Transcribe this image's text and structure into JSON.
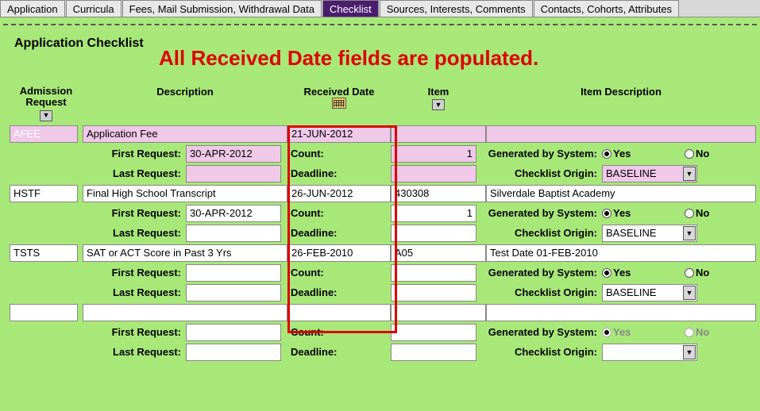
{
  "tabs": [
    "Application",
    "Curricula",
    "Fees, Mail Submission, Withdrawal Data",
    "Checklist",
    "Sources, Interests, Comments",
    "Contacts, Cohorts, Attributes"
  ],
  "active_tab_index": 3,
  "title": "Application Checklist",
  "annotation": "All Received Date fields are populated.",
  "columns": {
    "admission_request": "Admission\nRequest",
    "description": "Description",
    "received_date": "Received Date",
    "item": "Item",
    "item_description": "Item Description"
  },
  "labels": {
    "first_request": "First Request:",
    "last_request": "Last Request:",
    "count": "Count:",
    "deadline": "Deadline:",
    "generated_by_system": "Generated by System:",
    "checklist_origin": "Checklist Origin:",
    "yes": "Yes",
    "no": "No"
  },
  "rows": [
    {
      "code": "AFEE",
      "desc": "Application Fee",
      "received": "21-JUN-2012",
      "item": "",
      "item_desc": "",
      "first_request": "30-APR-2012",
      "last_request": "",
      "count": "1",
      "deadline": "",
      "gen_yes": true,
      "gen_disabled": false,
      "origin": "BASELINE",
      "highlight": true
    },
    {
      "code": "HSTF",
      "desc": "Final High School Transcript",
      "received": "26-JUN-2012",
      "item": "430308",
      "item_desc": "Silverdale Baptist Academy",
      "first_request": "30-APR-2012",
      "last_request": "",
      "count": "1",
      "deadline": "",
      "gen_yes": true,
      "gen_disabled": false,
      "origin": "BASELINE",
      "highlight": false
    },
    {
      "code": "TSTS",
      "desc": "SAT or ACT Score in Past 3 Yrs",
      "received": "26-FEB-2010",
      "item": "A05",
      "item_desc": "Test Date 01-FEB-2010",
      "first_request": "",
      "last_request": "",
      "count": "",
      "deadline": "",
      "gen_yes": true,
      "gen_disabled": false,
      "origin": "BASELINE",
      "highlight": false
    },
    {
      "code": "",
      "desc": "",
      "received": "",
      "item": "",
      "item_desc": "",
      "first_request": "",
      "last_request": "",
      "count": "",
      "deadline": "",
      "gen_yes": true,
      "gen_disabled": true,
      "origin": "",
      "highlight": false
    }
  ]
}
